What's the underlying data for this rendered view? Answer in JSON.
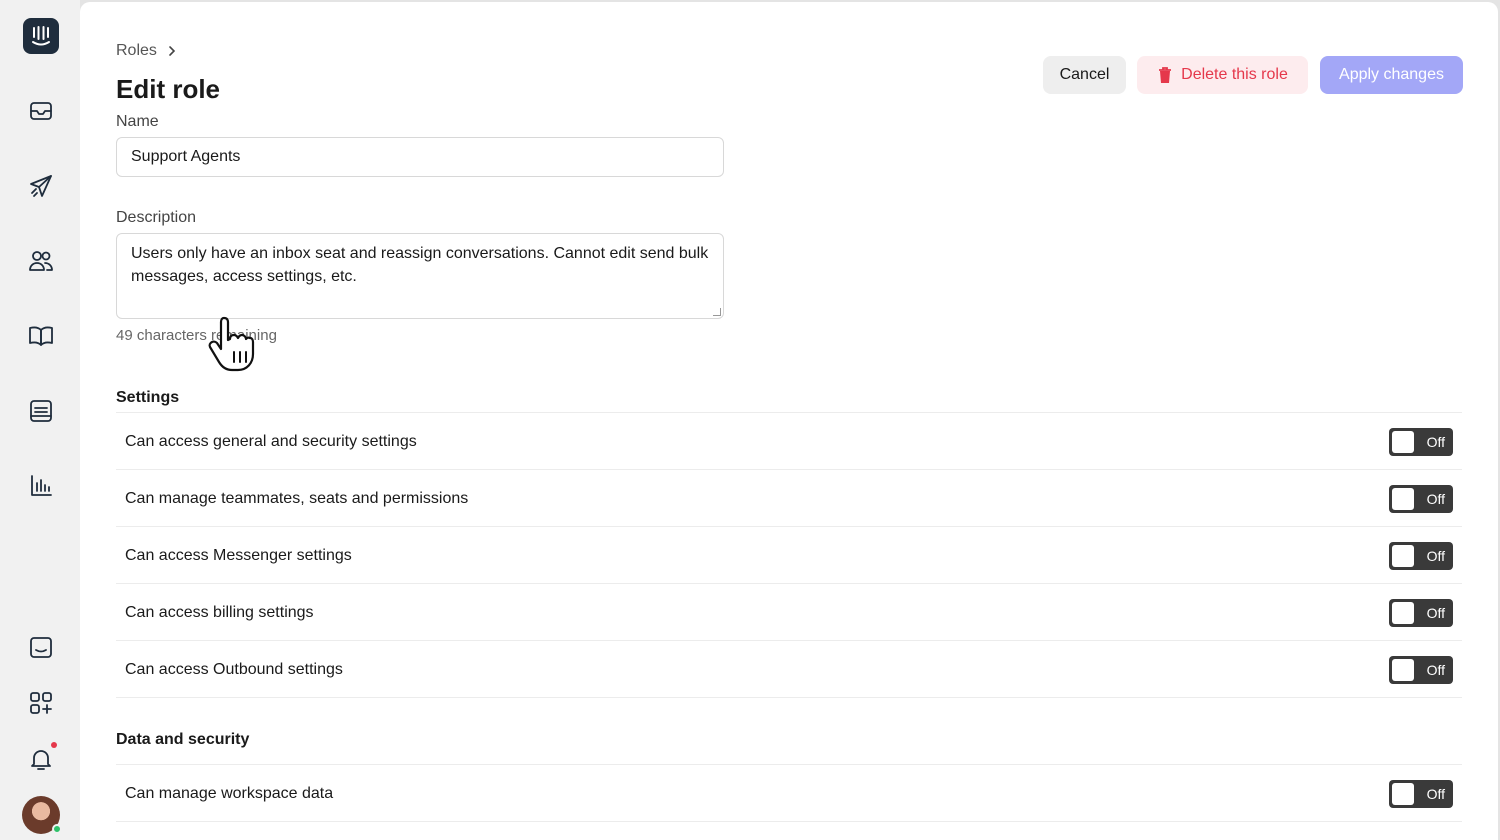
{
  "breadcrumb": {
    "root": "Roles"
  },
  "page": {
    "title": "Edit role"
  },
  "actions": {
    "cancel": "Cancel",
    "delete": "Delete this role",
    "apply": "Apply changes"
  },
  "form": {
    "name_label": "Name",
    "name_value": "Support Agents",
    "description_label": "Description",
    "description_value": "Users only have an inbox seat and reassign conversations. Cannot edit send bulk messages, access settings, etc.",
    "description_helper": "49 characters remaining"
  },
  "sections": [
    {
      "title": "Settings",
      "permissions": [
        {
          "label": "Can access general and security settings",
          "state": "Off"
        },
        {
          "label": "Can manage teammates, seats and permissions",
          "state": "Off"
        },
        {
          "label": "Can access Messenger settings",
          "state": "Off"
        },
        {
          "label": "Can access billing settings",
          "state": "Off"
        },
        {
          "label": "Can access Outbound settings",
          "state": "Off"
        }
      ]
    },
    {
      "title": "Data and security",
      "permissions": [
        {
          "label": "Can manage workspace data",
          "state": "Off"
        }
      ]
    }
  ],
  "sidebar": {
    "icons": [
      "inbox-icon",
      "outbound-icon",
      "contacts-icon",
      "articles-icon",
      "reports-list-icon",
      "chart-icon",
      "messenger-icon",
      "apps-icon",
      "bell-icon"
    ]
  },
  "colors": {
    "accent": "#a3a7f7",
    "danger": "#e5384b",
    "toggle_off": "#3a3a3a",
    "sidebar_bg": "#f1f1f1",
    "brand": "#1f2d3d"
  }
}
